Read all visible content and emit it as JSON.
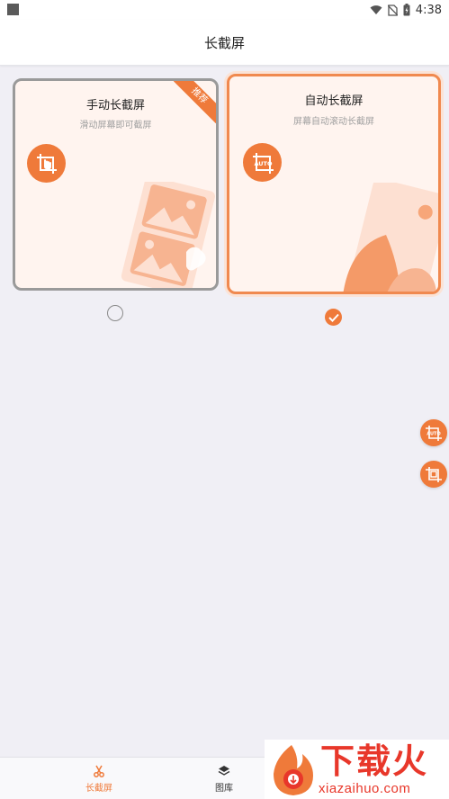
{
  "status_bar": {
    "time": "4:38",
    "icons": [
      "wifi-icon",
      "no-sim-icon",
      "battery-charging-icon"
    ]
  },
  "header": {
    "title": "长截屏"
  },
  "modes": {
    "manual": {
      "title": "手动长截屏",
      "subtitle": "滑动屏幕即可截屏",
      "badge": "推荐",
      "icon": "hand-crop-icon",
      "selected": false
    },
    "auto": {
      "title": "自动长截屏",
      "subtitle": "屏幕自动滚动长截屏",
      "icon": "auto-crop-icon",
      "selected": true
    }
  },
  "floating_buttons": [
    {
      "name": "auto-crop-icon",
      "label": "AUTO"
    },
    {
      "name": "crop-frame-icon"
    }
  ],
  "bottom_nav": {
    "items": [
      {
        "label": "长截屏",
        "icon": "scissors-icon",
        "active": true
      },
      {
        "label": "图库",
        "icon": "stack-icon",
        "active": false
      }
    ]
  },
  "watermark": {
    "text": "下载火",
    "url": "xiazaihuo.com"
  },
  "colors": {
    "accent": "#ef7a3a",
    "card_bg": "#fff4ef",
    "page_bg": "#f0eff5",
    "unselected_border": "#9a9a9a",
    "watermark_red": "#e8372a"
  }
}
